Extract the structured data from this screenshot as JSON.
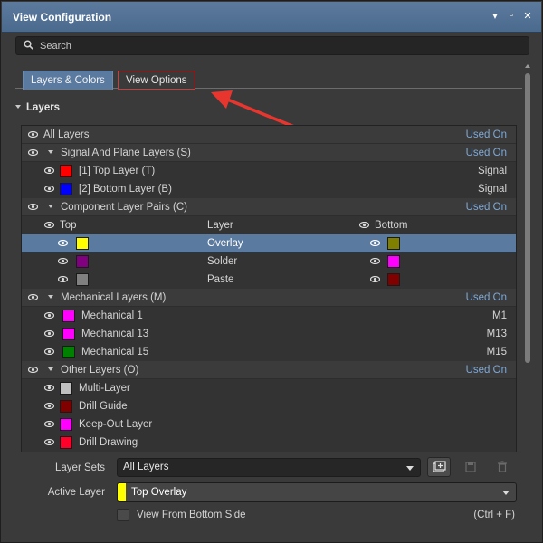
{
  "window": {
    "title": "View Configuration"
  },
  "search": {
    "placeholder": "Search"
  },
  "tabs": [
    {
      "label": "Layers & Colors",
      "active": true
    },
    {
      "label": "View Options",
      "active": false
    }
  ],
  "section": {
    "title": "Layers"
  },
  "layers": {
    "all_layers": {
      "label": "All Layers",
      "right": "Used On"
    },
    "signal_group": {
      "label": "Signal And Plane Layers (S)",
      "right": "Used On"
    },
    "signal_items": [
      {
        "label": "[1] Top Layer (T)",
        "color": "#ff0000",
        "right": "Signal"
      },
      {
        "label": "[2] Bottom Layer (B)",
        "color": "#0000ff",
        "right": "Signal"
      }
    ],
    "component_group": {
      "label": "Component Layer Pairs (C)",
      "right": "Used On"
    },
    "component_header": {
      "top": "Top",
      "layer": "Layer",
      "bottom": "Bottom"
    },
    "component_pairs": [
      {
        "layer": "Overlay",
        "top_color": "#ffff00",
        "bottom_color": "#808000",
        "selected": true
      },
      {
        "layer": "Solder",
        "top_color": "#800080",
        "bottom_color": "#ff00ff",
        "selected": false
      },
      {
        "layer": "Paste",
        "top_color": "#808080",
        "bottom_color": "#800000",
        "selected": false
      }
    ],
    "mechanical_group": {
      "label": "Mechanical Layers (M)",
      "right": "Used On"
    },
    "mechanical_items": [
      {
        "label": "Mechanical 1",
        "color": "#ff00ff",
        "right": "M1"
      },
      {
        "label": "Mechanical 13",
        "color": "#ff00ff",
        "right": "M13"
      },
      {
        "label": "Mechanical 15",
        "color": "#008000",
        "right": "M15"
      }
    ],
    "other_group": {
      "label": "Other Layers (O)",
      "right": "Used On"
    },
    "other_items": [
      {
        "label": "Multi-Layer",
        "color": "#c0c0c0"
      },
      {
        "label": "Drill Guide",
        "color": "#800000"
      },
      {
        "label": "Keep-Out Layer",
        "color": "#ff00ff"
      },
      {
        "label": "Drill Drawing",
        "color": "#ff002a"
      }
    ]
  },
  "layer_sets": {
    "label": "Layer Sets",
    "value": "All Layers"
  },
  "active_layer": {
    "label": "Active Layer",
    "value": "Top Overlay",
    "color": "#ffff00"
  },
  "view_bottom": {
    "label": "View From Bottom Side",
    "shortcut": "(Ctrl + F)",
    "checked": false
  }
}
